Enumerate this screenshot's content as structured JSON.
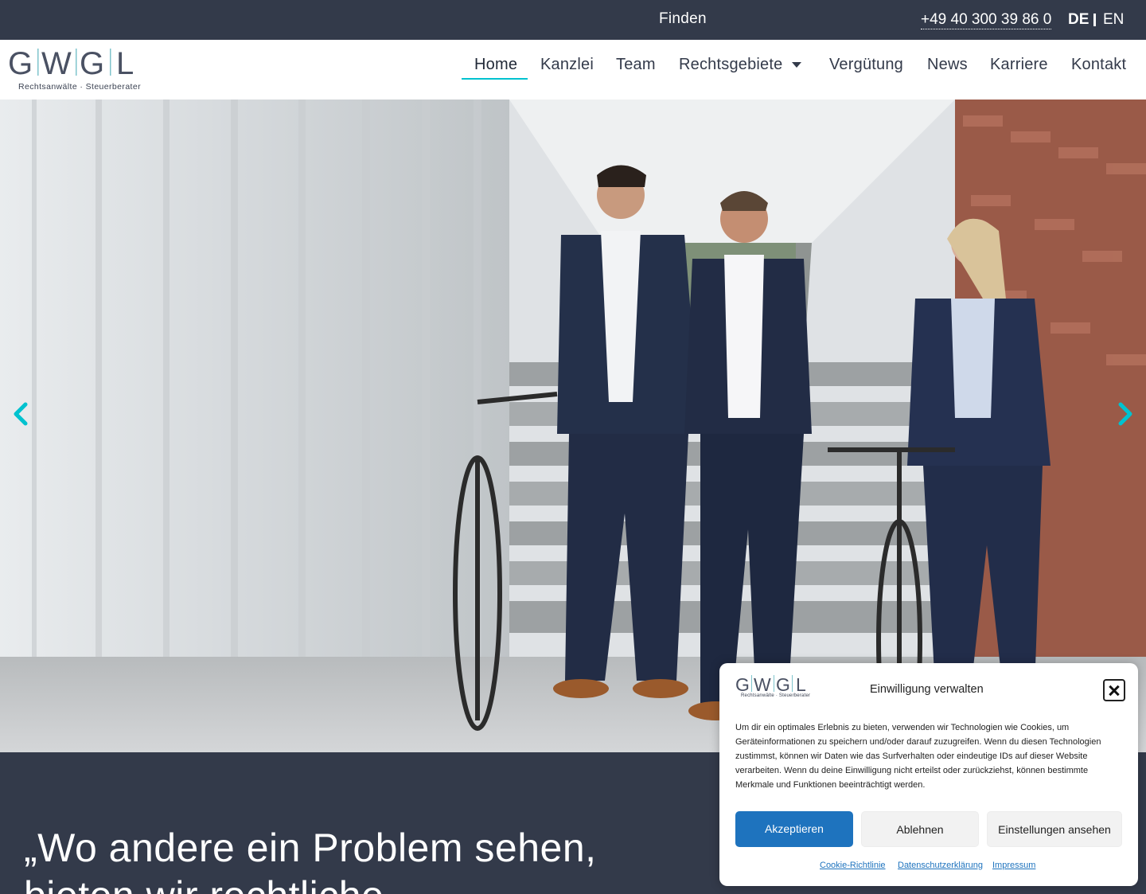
{
  "topbar": {
    "find_label": "Finden",
    "phone": "+49 40 300 39 86 0",
    "lang_active": "DE",
    "lang_other": "EN"
  },
  "header": {
    "logo_text": "G|W|G|L",
    "logo_subtitle": "Rechtsanwälte · Steuerberater",
    "nav": [
      {
        "label": "Home",
        "active": true
      },
      {
        "label": "Kanzlei"
      },
      {
        "label": "Team"
      },
      {
        "label": "Rechtsgebiete",
        "has_dropdown": true
      },
      {
        "label": "Vergütung"
      },
      {
        "label": "News"
      },
      {
        "label": "Karriere"
      },
      {
        "label": "Kontakt"
      }
    ]
  },
  "hero": {
    "arrow_color": "#00c2cf"
  },
  "quote": {
    "line1": "„Wo andere ein Problem sehen,",
    "line2": "bieten wir rechtliche"
  },
  "cookie": {
    "logo_subtitle": "Rechtsanwälte · Steuerberater",
    "title": "Einwilligung verwalten",
    "text": "Um dir ein optimales Erlebnis zu bieten, verwenden wir Technologien wie Cookies, um Geräteinformationen zu speichern und/oder darauf zuzugreifen. Wenn du diesen Technologien zustimmst, können wir Daten wie das Surfverhalten oder eindeutige IDs auf dieser Website verarbeiten. Wenn du deine Einwilligung nicht erteilst oder zurückziehst, können bestimmte Merkmale und Funktionen beeinträchtigt werden.",
    "accept_label": "Akzeptieren",
    "deny_label": "Ablehnen",
    "settings_label": "Einstellungen ansehen",
    "links": [
      "Cookie-Richtlinie",
      "Datenschutzerklärung",
      "Impressum"
    ]
  },
  "colors": {
    "navy": "#333a4a",
    "accent": "#00c2cf",
    "button_blue": "#1e73be"
  }
}
